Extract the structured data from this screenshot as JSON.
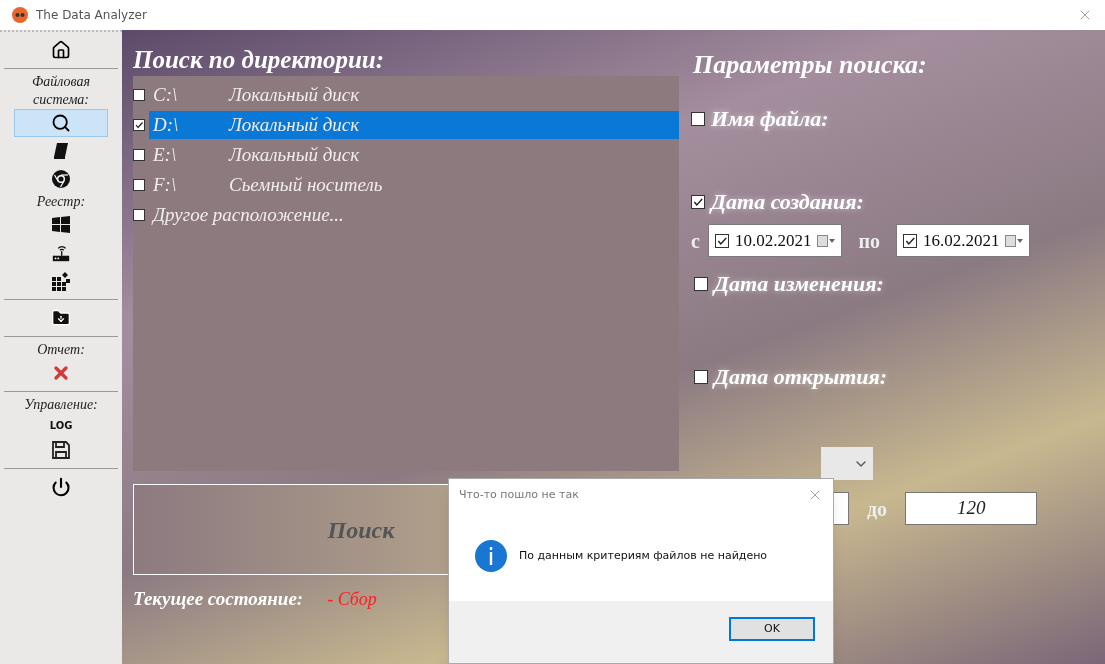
{
  "window": {
    "title": "The Data Analyzer"
  },
  "sidebar": {
    "items": [
      {
        "kind": "button",
        "selected": false
      },
      {
        "kind": "divider"
      },
      {
        "kind": "label",
        "text": "Файловая система:"
      },
      {
        "kind": "button",
        "selected": true
      },
      {
        "kind": "button",
        "selected": false
      },
      {
        "kind": "button",
        "selected": false
      },
      {
        "kind": "label",
        "text": "Реестр:"
      },
      {
        "kind": "button",
        "selected": false
      },
      {
        "kind": "button",
        "selected": false
      },
      {
        "kind": "button",
        "selected": false
      },
      {
        "kind": "divider"
      },
      {
        "kind": "button",
        "selected": false
      },
      {
        "kind": "divider"
      },
      {
        "kind": "label",
        "text": "Отчет:"
      },
      {
        "kind": "button",
        "selected": false
      },
      {
        "kind": "divider"
      },
      {
        "kind": "label",
        "text": "Управление:"
      },
      {
        "kind": "text",
        "text": "LOG"
      },
      {
        "kind": "button",
        "selected": false
      },
      {
        "kind": "divider"
      },
      {
        "kind": "button",
        "selected": false
      }
    ]
  },
  "directory": {
    "title": "Поиск по директории:",
    "items": [
      {
        "drive": "C:\\",
        "name": "Локальный диск",
        "checked": false,
        "selected": false
      },
      {
        "drive": "D:\\",
        "name": "Локальный диск",
        "checked": true,
        "selected": true
      },
      {
        "drive": "E:\\",
        "name": "Локальный диск",
        "checked": false,
        "selected": false
      },
      {
        "drive": "F:\\",
        "name": "Сьемный носитель",
        "checked": false,
        "selected": false
      },
      {
        "name": "Другое расположение...",
        "checked": false,
        "selected": false
      }
    ]
  },
  "search_button": "Поиск",
  "status": {
    "label": "Текущее состояние:",
    "value": "- Сбор"
  },
  "parameters": {
    "title": "Параметры поиска:",
    "file_name": {
      "label": "Имя файла:",
      "checked": false
    },
    "created": {
      "label": "Дата создания:",
      "checked": true,
      "from_label": "с",
      "from": {
        "value": "10.02.2021",
        "checked": true
      },
      "to_label": "по",
      "to": {
        "value": "16.02.2021",
        "checked": true
      }
    },
    "modified": {
      "label": "Дата изменения:",
      "checked": false
    },
    "opened": {
      "label": "Дата открытия:",
      "checked": false
    },
    "size": {
      "to_label": "до",
      "to": "120"
    }
  },
  "dialog": {
    "title": "Что-то пошло не так",
    "message": "По данным критериям файлов не найдено",
    "button": "OK"
  }
}
